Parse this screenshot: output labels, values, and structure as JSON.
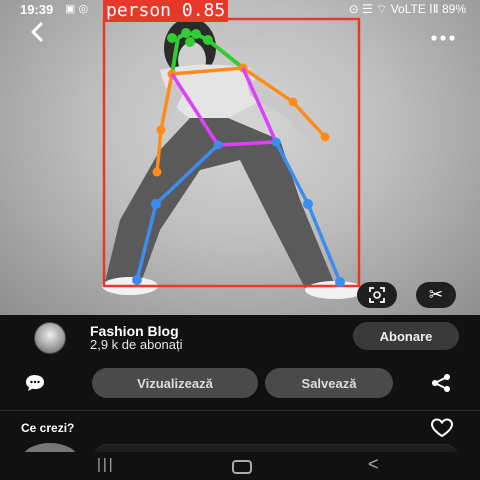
{
  "status_bar": {
    "time": "19:39",
    "left_icons": "▣ ◎",
    "battery": "89%",
    "right_icons": "⊙ ☰ ⌔ VoLTE ⅠⅡ"
  },
  "detection": {
    "label": "person 0.85",
    "box_color": "#e8382a",
    "skeleton_colors": {
      "face": "#33cc33",
      "arms": "#ff8c1a",
      "torso": "#e040fb",
      "legs": "#3b8ef0"
    }
  },
  "top_bar": {
    "back_icon": "chevron-left-icon",
    "more_icon": "more-horizontal-icon"
  },
  "image_actions": {
    "lens_icon": "visual-search-icon",
    "crop_icon": "scissors-icon"
  },
  "profile": {
    "name": "Fashion Blog",
    "subscribers": "2,9 k de abonați",
    "subscribe_label": "Abonare"
  },
  "actions": {
    "view_label": "Vizualizează",
    "save_label": "Salvează"
  },
  "comments": {
    "prompt": "Ce crezi?"
  },
  "nav": {
    "recent": "|||",
    "back": "<"
  }
}
